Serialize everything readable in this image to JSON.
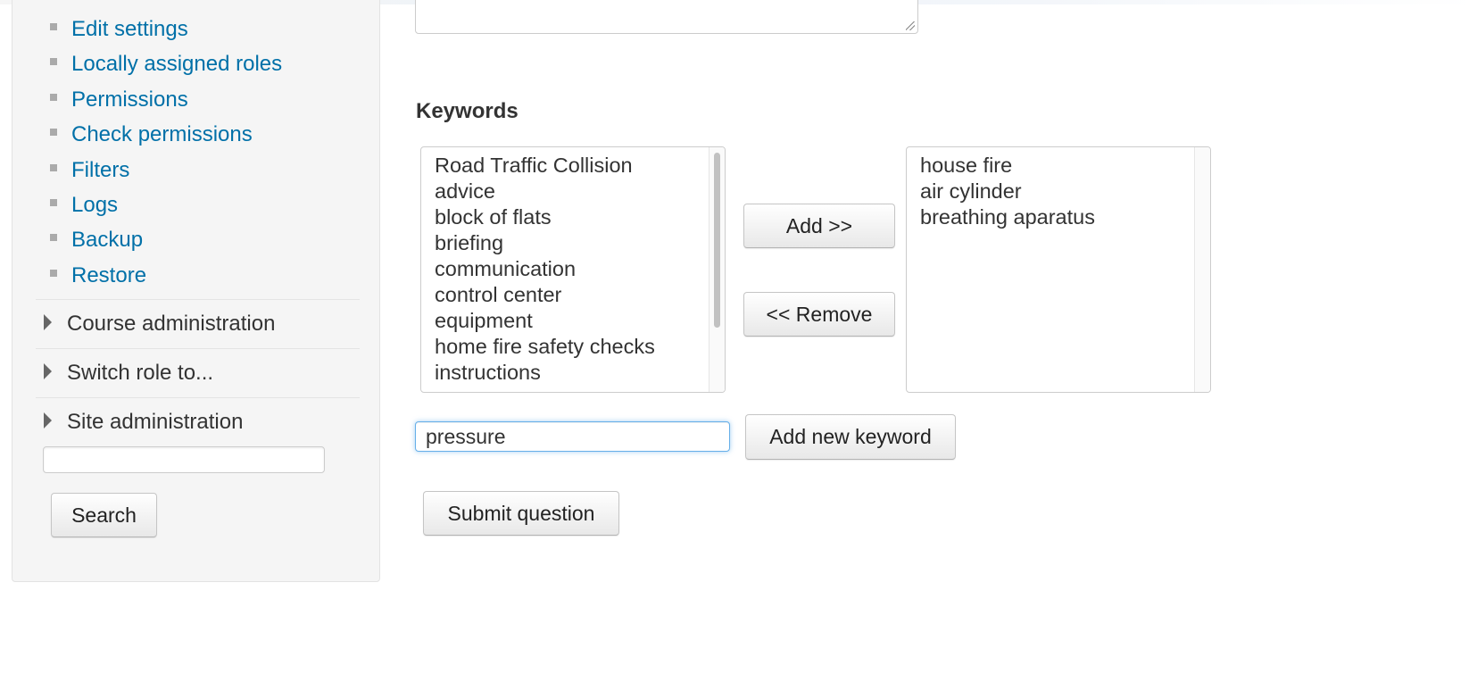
{
  "sidebar": {
    "nav_items": [
      {
        "label": "Edit settings"
      },
      {
        "label": "Locally assigned roles"
      },
      {
        "label": "Permissions"
      },
      {
        "label": "Check permissions"
      },
      {
        "label": "Filters"
      },
      {
        "label": "Logs"
      },
      {
        "label": "Backup"
      },
      {
        "label": "Restore"
      }
    ],
    "sections": [
      {
        "label": "Course administration"
      },
      {
        "label": "Switch role to..."
      },
      {
        "label": "Site administration"
      }
    ],
    "search_value": "",
    "search_button_label": "Search"
  },
  "keywords": {
    "heading": "Keywords",
    "available": [
      "Road Traffic Collision",
      "advice",
      "block of flats",
      "briefing",
      "communication",
      "control center",
      "equipment",
      "home fire safety checks",
      "instructions"
    ],
    "selected": [
      "house fire",
      "air cylinder",
      "breathing aparatus"
    ],
    "add_button_label": "Add >>",
    "remove_button_label": "<< Remove",
    "new_keyword_value": "pressure",
    "add_new_keyword_label": "Add new keyword",
    "submit_label": "Submit question"
  },
  "colors": {
    "link": "#0070a8",
    "focus_border": "#66afe9",
    "sidebar_bg": "#f5f5f5"
  },
  "icons": {
    "nav_bullet": "square-bullet-icon",
    "section_toggle": "triangle-right-icon"
  }
}
